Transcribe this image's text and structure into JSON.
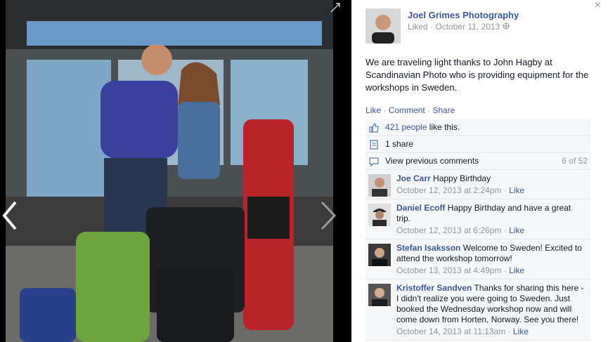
{
  "window": {
    "close_glyph": "×"
  },
  "post": {
    "page_name": "Joel Grimes Photography",
    "status": "Liked",
    "date": "October 11, 2013",
    "audience_icon": "globe-icon",
    "text": "We are traveling light thanks to John Hagby at Scandinavian Photo who is providing equipment for the workshops in Sweden.",
    "actions": {
      "like": "Like",
      "comment": "Comment",
      "share": "Share",
      "separator": "·"
    }
  },
  "feedback": {
    "likes": {
      "link": "421 people",
      "rest": " like this."
    },
    "shares": "1 share",
    "view_previous": "View previous comments",
    "count": "6 of 52"
  },
  "comments": [
    {
      "name": "Joe Carr",
      "text": " Happy Birthday",
      "date": "October 12, 2013 at 2:24pm",
      "like": "Like"
    },
    {
      "name": "Daniel Ecoff",
      "text": " Happy Birthday and have a great trip.",
      "date": "October 12, 2013 at 6:26pm",
      "like": "Like"
    },
    {
      "name": "Stefan Isaksson",
      "text": " Welcome to Sweden! Excited to attend the workshop tomorrow!",
      "date": "October 13, 2013 at 4:49pm",
      "like": "Like"
    },
    {
      "name": "Kristoffer Sandven",
      "text": " Thanks for sharing this here - I didn't realize you were going to Sweden. Just booked the Wednesday workshop now and will come down from Horten, Norway. See you there!",
      "date": "October 14, 2013 at 11:13am",
      "like": "Like"
    }
  ],
  "colors": {
    "link": "#3b5998",
    "meta": "#90949c",
    "panel": "#f6f7f9"
  }
}
